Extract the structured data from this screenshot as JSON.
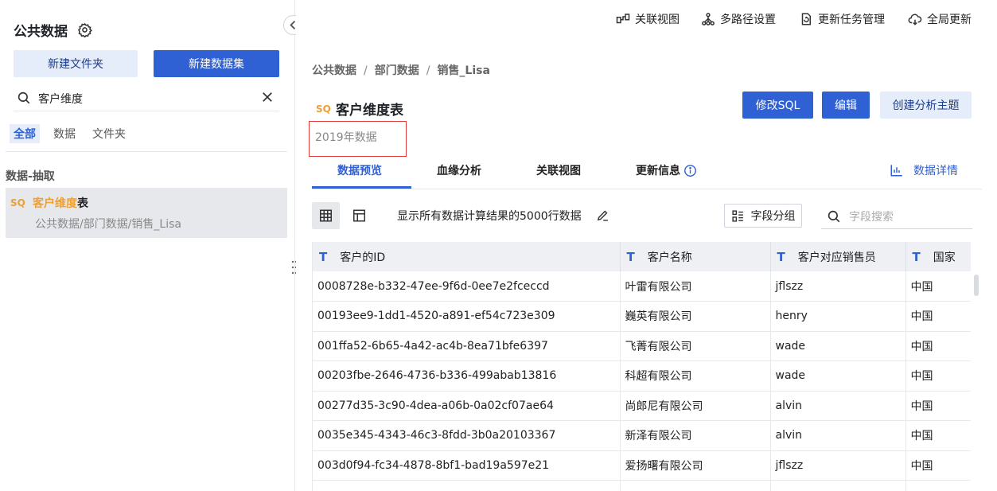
{
  "sidebar": {
    "title": "公共数据",
    "new_folder": "新建文件夹",
    "new_dataset": "新建数据集",
    "search_value": "客户维度",
    "filters": [
      "全部",
      "数据",
      "文件夹"
    ],
    "group_title": "数据-抽取",
    "result": {
      "type_tag": "SQL",
      "name_highlight": "客户维度",
      "name_rest": "表",
      "path": "公共数据/部门数据/销售_Lisa"
    }
  },
  "toolbar": {
    "relation_view": "关联视图",
    "multipath": "多路径设置",
    "update_tasks": "更新任务管理",
    "global_update": "全局更新"
  },
  "main": {
    "breadcrumb": [
      "公共数据",
      "部门数据",
      "销售_Lisa"
    ],
    "breadcrumb_sep": "/",
    "type_tag": "SQL",
    "title": "客户维度表",
    "description": "2019年数据",
    "buttons": {
      "modify_sql": "修改SQL",
      "edit": "编辑",
      "create_topic": "创建分析主题"
    },
    "tabs": [
      "数据预览",
      "血缘分析",
      "关联视图",
      "更新信息"
    ],
    "detail_link": "数据详情",
    "calc_note": "显示所有数据计算结果的5000行数据",
    "field_group": "字段分组",
    "field_search_placeholder": "字段搜索"
  },
  "table": {
    "field_type_glyph": "T",
    "columns": [
      "客户的ID",
      "客户名称",
      "客户对应销售员",
      "国家"
    ],
    "rows": [
      [
        "0008728e-b332-47ee-9f6d-0ee7e2fceccd",
        "叶雷有限公司",
        "jflszz",
        "中国"
      ],
      [
        "00193ee9-1dd1-4520-a891-ef54c723e309",
        "巍英有限公司",
        "henry",
        "中国"
      ],
      [
        "001ffa52-6b65-4a42-ac4b-8ea71bfe6397",
        "飞菁有限公司",
        "wade",
        "中国"
      ],
      [
        "00203fbe-2646-4736-b336-499abab13816",
        "科超有限公司",
        "wade",
        "中国"
      ],
      [
        "00277d35-3c90-4dea-a06b-0a02cf07ae64",
        "尚郎尼有限公司",
        "alvin",
        "中国"
      ],
      [
        "0035e345-4343-46c3-8fdd-3b0a20103367",
        "新泽有限公司",
        "alvin",
        "中国"
      ],
      [
        "003d0f94-fc34-4878-8bf1-bad19a597e21",
        "爱扬曙有限公司",
        "jflszz",
        "中国"
      ],
      [
        "",
        "",
        "",
        ""
      ]
    ]
  },
  "colors": {
    "primary": "#2f60d4",
    "highlight": "#f0a030",
    "sql_tag": "#e8a03b",
    "red_box": "#e03b3b"
  }
}
